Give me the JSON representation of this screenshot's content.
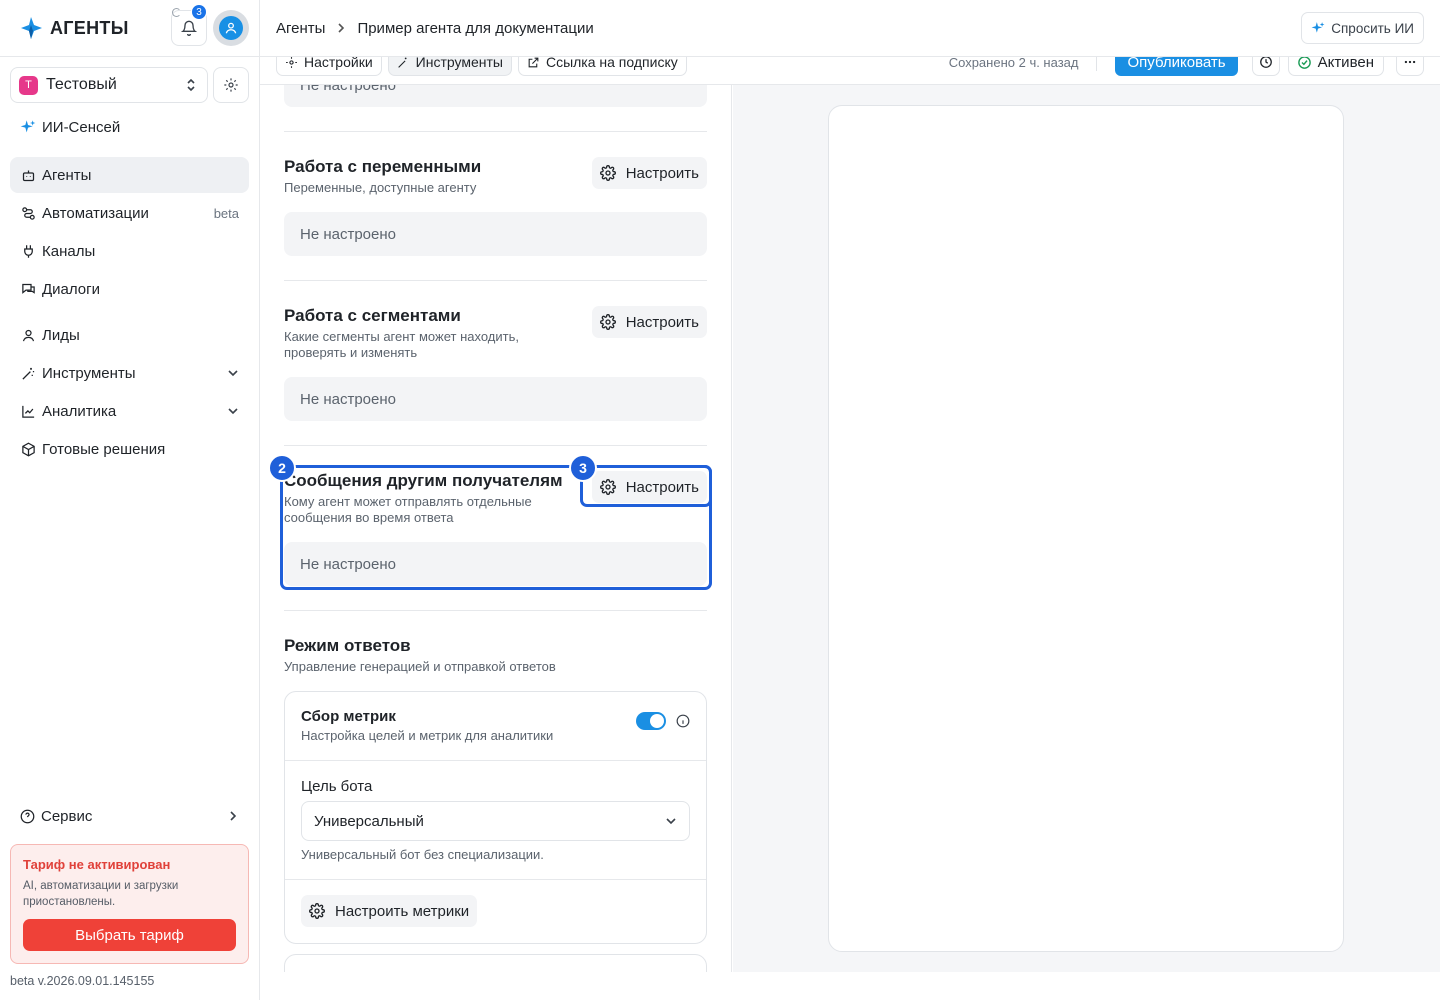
{
  "brand": {
    "name": "АГЕНТЫ"
  },
  "notifications": {
    "count": "3"
  },
  "workspace": {
    "initial": "Т",
    "name": "Тестовый"
  },
  "nav": {
    "ai_sensei": "ИИ-Сенсей",
    "items": [
      {
        "label": "Агенты",
        "badge": ""
      },
      {
        "label": "Автоматизации",
        "badge": "beta"
      },
      {
        "label": "Каналы",
        "badge": ""
      },
      {
        "label": "Диалоги",
        "badge": ""
      },
      {
        "label": "Лиды",
        "badge": ""
      },
      {
        "label": "Инструменты",
        "badge": ""
      },
      {
        "label": "Аналитика",
        "badge": ""
      },
      {
        "label": "Готовые решения",
        "badge": ""
      }
    ],
    "service": "Сервис"
  },
  "tariff": {
    "title": "Тариф не активирован",
    "desc": "AI, автоматизации и загрузки приостановлены.",
    "button": "Выбрать тариф"
  },
  "version": "beta v.2026.09.01.145155",
  "breadcrumb": {
    "root": "Агенты",
    "current": "Пример агента для документации"
  },
  "ask_ai": "Спросить ИИ",
  "toolbar": {
    "tabs": [
      "Настройки",
      "Инструменты",
      "Ссылка на подписку"
    ],
    "saved": "Сохранено 2 ч. назад",
    "publish": "Опубликовать",
    "status": "Активен"
  },
  "sections": {
    "top_placeholder": "Не настроено",
    "variables": {
      "title": "Работа с переменными",
      "desc": "Переменные, доступные агенту",
      "button": "Настроить",
      "value": "Не настроено"
    },
    "segments": {
      "title": "Работа с сегментами",
      "desc": "Какие сегменты агент может находить, проверять и изменять",
      "button": "Настроить",
      "value": "Не настроено"
    },
    "messages": {
      "title": "Сообщения другим получателям",
      "desc": "Кому агент может отправлять отдельные сообщения во время ответа",
      "button": "Настроить",
      "value": "Не настроено"
    },
    "response_mode": {
      "title": "Режим ответов",
      "desc": "Управление генерацией и отправкой ответов"
    }
  },
  "metrics": {
    "title": "Сбор метрик",
    "desc": "Настройка целей и метрик для аналитики",
    "goal_label": "Цель бота",
    "goal_value": "Универсальный",
    "goal_hint": "Универсальный бот без специализации.",
    "button": "Настроить метрики"
  },
  "annotations": {
    "n2": "2",
    "n3": "3"
  },
  "colors": {
    "accent": "#1a8fe3",
    "highlight": "#1f5fd9",
    "danger": "#ef4138"
  }
}
